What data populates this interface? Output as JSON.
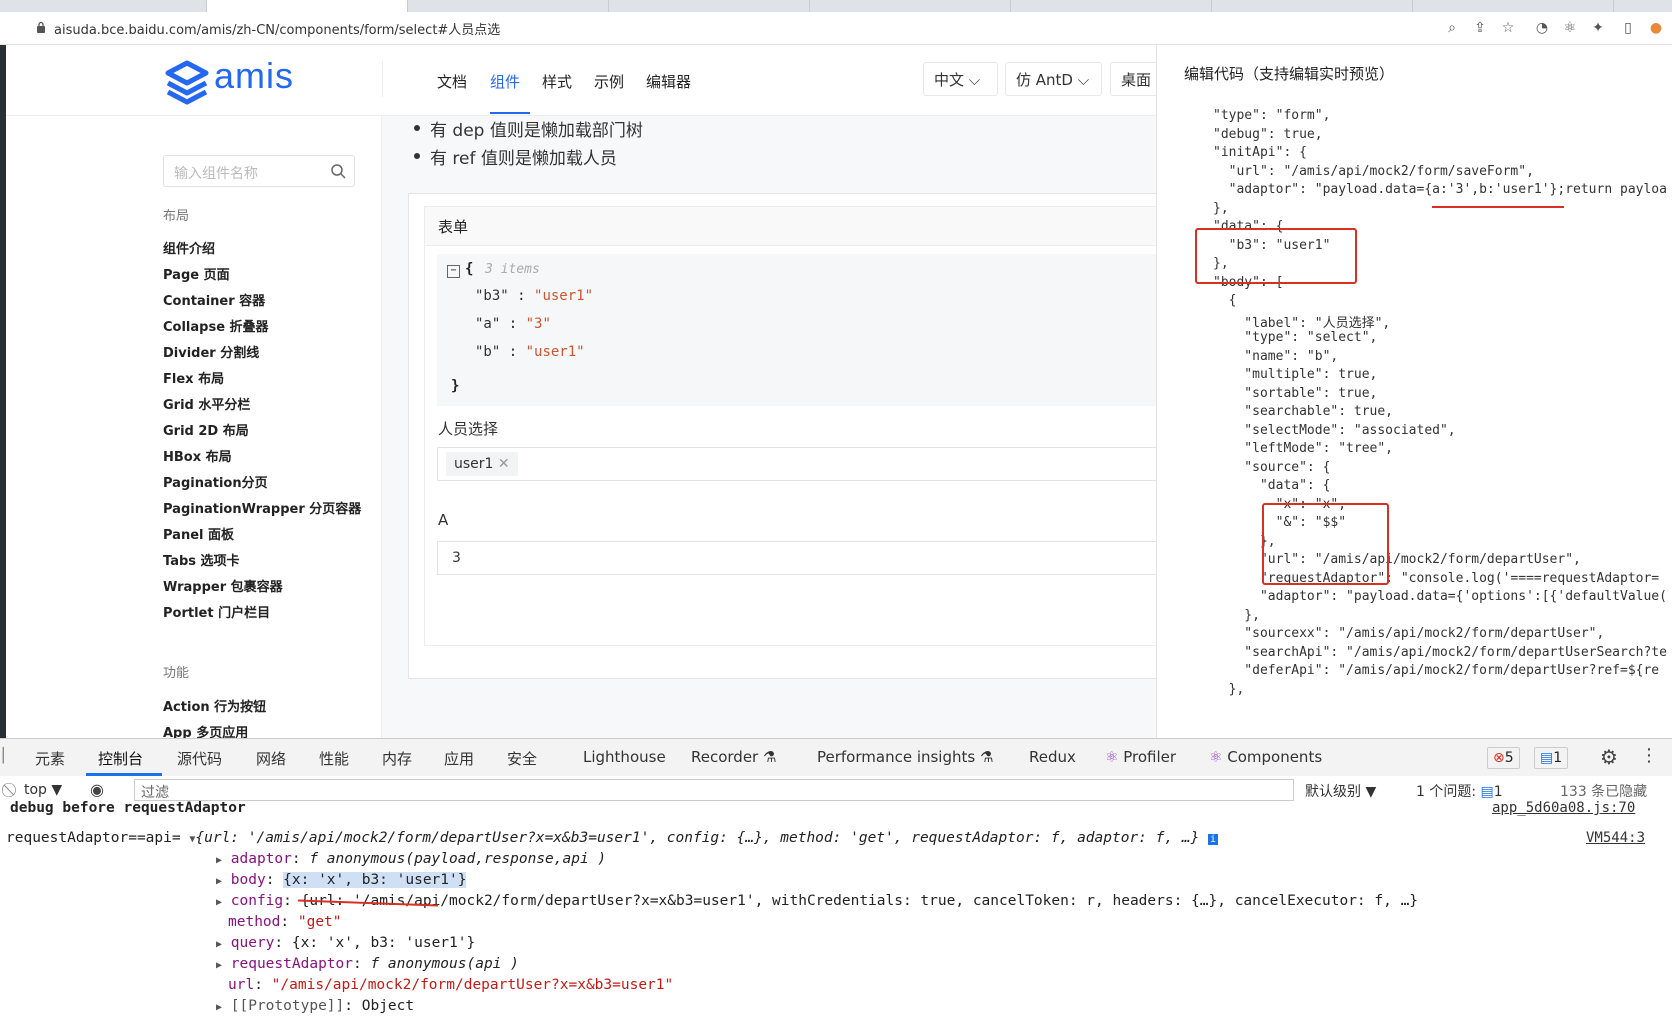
{
  "browser": {
    "url": "aisuda.bce.baidu.com/amis/zh-CN/components/form/select#人员点选"
  },
  "header": {
    "logo_text": "amis",
    "nav": [
      "文档",
      "组件",
      "样式",
      "示例",
      "编辑器"
    ],
    "lang_select": "中文",
    "theme_select": "仿 AntD",
    "desktop_label": "桌面"
  },
  "sidebar": {
    "search_placeholder": "输入组件名称",
    "group_layout": "布局",
    "items": [
      "组件介绍",
      "Page 页面",
      "Container 容器",
      "Collapse 折叠器",
      "Divider 分割线",
      "Flex 布局",
      "Grid 水平分栏",
      "Grid 2D 布局",
      "HBox 布局",
      "Pagination分页",
      "PaginationWrapper 分页容器",
      "Panel 面板",
      "Tabs 选项卡",
      "Wrapper 包裹容器",
      "Portlet 门户栏目"
    ],
    "group_function": "功能",
    "items2": [
      "Action 行为按钮",
      "App 多页应用"
    ]
  },
  "main": {
    "bullets": [
      "有 dep 值则是懒加载部门树",
      "有 ref 值则是懒加载人员"
    ],
    "panel_title": "表单",
    "json_count": "3 items",
    "json_rows": [
      {
        "key": "\"b3\"",
        "value": "\"user1\""
      },
      {
        "key": "\"a\"",
        "value": "\"3\""
      },
      {
        "key": "\"b\"",
        "value": "\"user1\""
      }
    ],
    "field1_label": "人员选择",
    "field1_tag": "user1",
    "field2_label": "A",
    "field2_value": "3"
  },
  "editor": {
    "title": "编辑代码（支持编辑实时预览）",
    "lines": [
      "\"type\": \"form\",",
      "\"debug\": true,",
      "\"initApi\": {",
      "  \"url\": \"/amis/api/mock2/form/saveForm\",",
      "  \"adaptor\": \"payload.data={a:'3',b:'user1'};return payloa",
      "},",
      "\"data\": {",
      "  \"b3\": \"user1\"",
      "},",
      "\"body\": [",
      "  {",
      "    \"label\": \"人员选择\",",
      "    \"type\": \"select\",",
      "    \"name\": \"b\",",
      "    \"multiple\": true,",
      "    \"sortable\": true,",
      "    \"searchable\": true,",
      "    \"selectMode\": \"associated\",",
      "    \"leftMode\": \"tree\",",
      "    \"source\": {",
      "      \"data\": {",
      "        \"x\": \"x\",",
      "        \"&\": \"$$\"",
      "      },",
      "      \"url\": \"/amis/api/mock2/form/departUser\",",
      "      \"requestAdaptor\": \"console.log('====requestAdaptor=",
      "      \"adaptor\": \"payload.data={'options':[{'defaultValue(",
      "    },",
      "    \"sourcexx\": \"/amis/api/mock2/form/departUser\",",
      "    \"searchApi\": \"/amis/api/mock2/form/departUserSearch?te",
      "    \"deferApi\": \"/amis/api/mock2/form/departUser?ref=${re",
      "  },"
    ]
  },
  "devtools": {
    "tabs": [
      "元素",
      "控制台",
      "源代码",
      "网络",
      "性能",
      "内存",
      "应用",
      "安全",
      "Lighthouse",
      "Recorder",
      "Performance insights",
      "Redux",
      "Profiler",
      "Components"
    ],
    "error_count": "5",
    "message_count": "1",
    "context": "top",
    "filter_placeholder": "过滤",
    "level": "默认级别",
    "issues_label": "1 个问题:",
    "issues_count": "1",
    "hidden": "133 条已隐藏"
  },
  "console": {
    "line0": "debug before requestAdaptor",
    "line0_src": "app_5d60a08.js:70",
    "line1_prefix": "requestAdaptor==api=",
    "line1_obj": "{url: '/amis/api/mock2/form/departUser?x=x&b3=user1', config: {…}, method: 'get', requestAdaptor: f, adaptor: f, …}",
    "line1_src": "VM544:3",
    "props": [
      {
        "key": "adaptor",
        "value": "f anonymous(payload,response,api )"
      },
      {
        "key": "body",
        "value": "{x: 'x', b3: 'user1'}"
      },
      {
        "key": "config",
        "value": "{url: '/amis/api/mock2/form/departUser?x=x&b3=user1', withCredentials: true, cancelToken: r, headers: {…}, cancelExecutor: f, …}"
      },
      {
        "key": "method",
        "value": "\"get\""
      },
      {
        "key": "query",
        "value": "{x: 'x', b3: 'user1'}"
      },
      {
        "key": "requestAdaptor",
        "value": "f anonymous(api )"
      },
      {
        "key": "url",
        "value": "\"/amis/api/mock2/form/departUser?x=x&b3=user1\""
      },
      {
        "key": "[[Prototype]]",
        "value": "Object"
      }
    ]
  }
}
